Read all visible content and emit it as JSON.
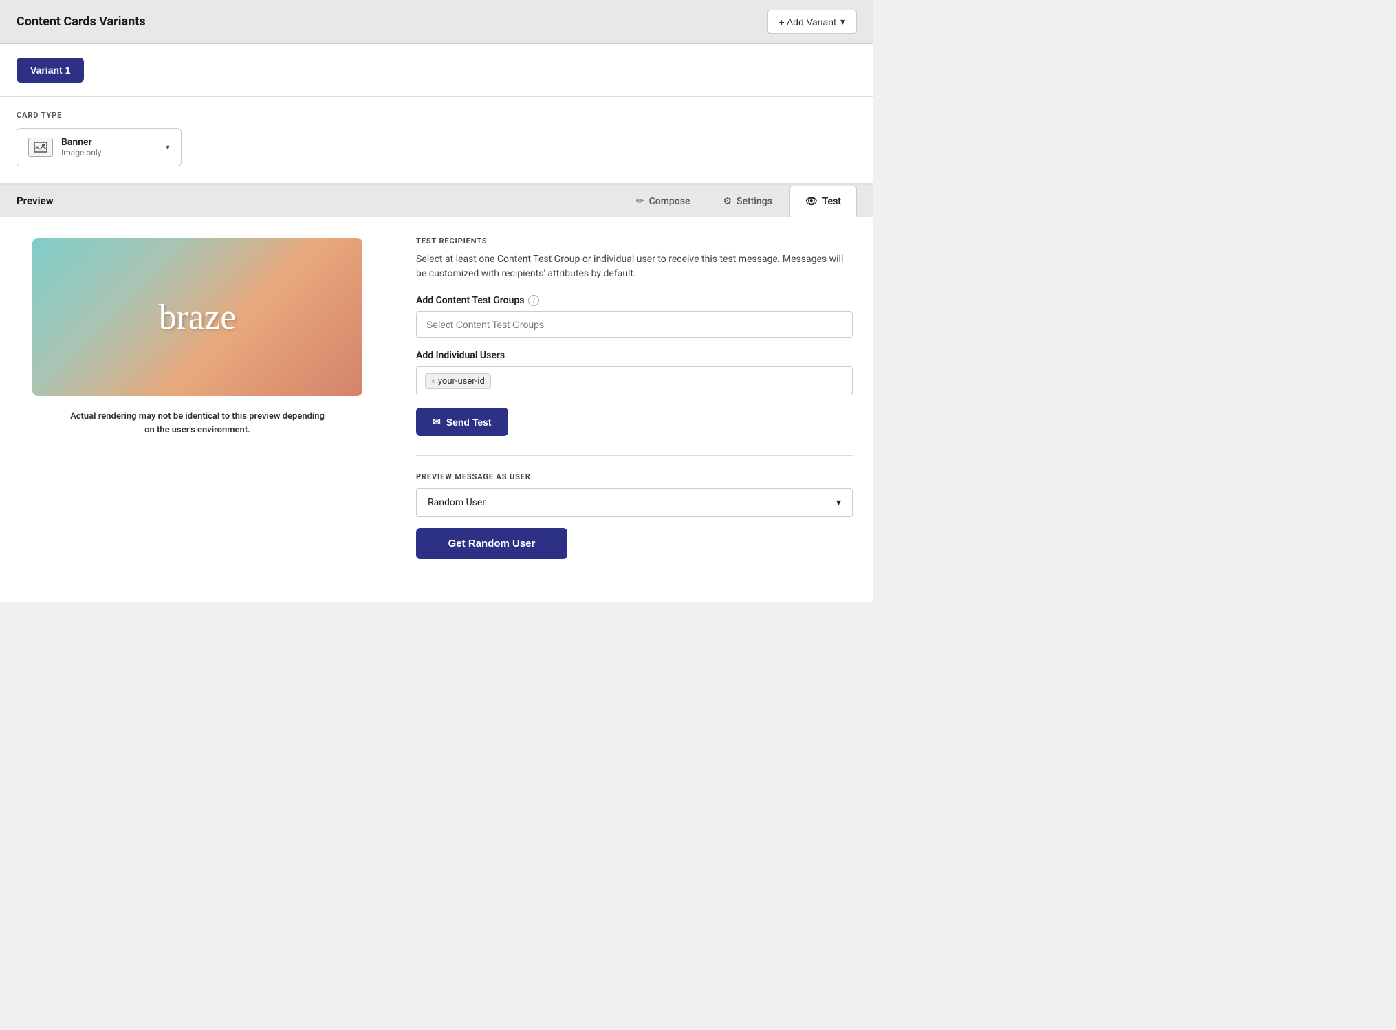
{
  "header": {
    "title": "Content Cards Variants",
    "add_variant_btn": "+ Add Variant"
  },
  "variant": {
    "label": "Variant 1"
  },
  "card_type": {
    "section_label": "CARD TYPE",
    "selected_name": "Banner",
    "selected_sub": "Image only"
  },
  "preview_area": {
    "label": "Preview",
    "tabs": [
      {
        "id": "compose",
        "label": "Compose",
        "icon": "pencil"
      },
      {
        "id": "settings",
        "label": "Settings",
        "icon": "gear"
      },
      {
        "id": "test",
        "label": "Test",
        "icon": "eye",
        "active": true
      }
    ]
  },
  "test_recipients": {
    "section_title": "TEST RECIPIENTS",
    "description": "Select at least one Content Test Group or individual user to receive this test message. Messages will be customized with recipients' attributes by default.",
    "content_test_groups_label": "Add Content Test Groups",
    "content_test_groups_placeholder": "Select Content Test Groups",
    "individual_users_label": "Add Individual Users",
    "user_tag": "your-user-id",
    "send_test_btn": "Send Test"
  },
  "preview_as_user": {
    "section_title": "PREVIEW MESSAGE AS USER",
    "dropdown_value": "Random User",
    "get_random_btn": "Get Random User"
  },
  "preview_panel": {
    "disclaimer": "Actual rendering may not be identical to this preview depending on the user's environment."
  }
}
